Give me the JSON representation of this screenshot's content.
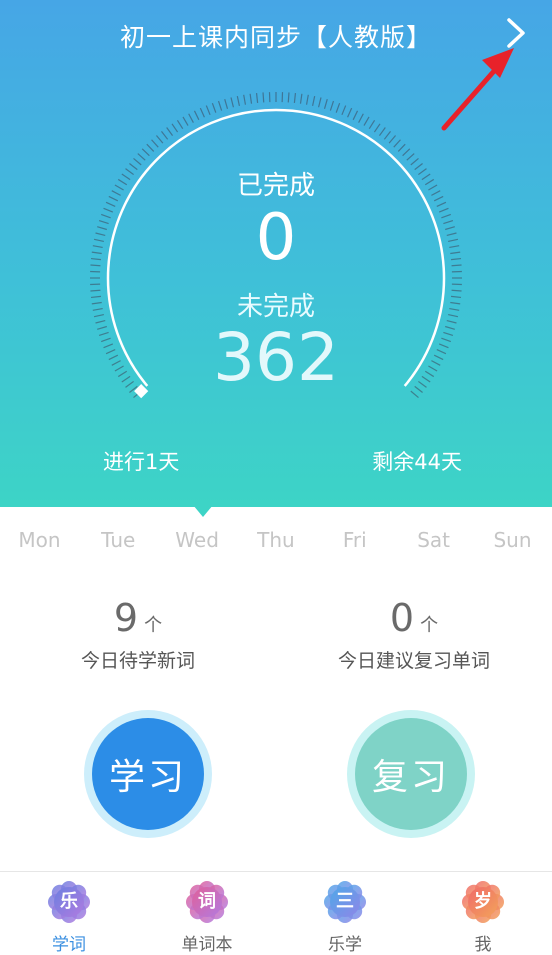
{
  "header": {
    "title": "初一上课内同步【人教版】"
  },
  "progress": {
    "completed_label": "已完成",
    "completed_value": "0",
    "remaining_label": "未完成",
    "remaining_value": "362",
    "days_elapsed": "进行1天",
    "days_left": "剩余44天",
    "fraction": 0
  },
  "week": {
    "days": [
      "Mon",
      "Tue",
      "Wed",
      "Thu",
      "Fri",
      "Sat",
      "Sun"
    ],
    "selected": "Wed"
  },
  "stats": {
    "new_words": {
      "value": "9",
      "unit": "个",
      "label": "今日待学新词"
    },
    "review_words": {
      "value": "0",
      "unit": "个",
      "label": "今日建议复习单词"
    }
  },
  "actions": {
    "learn": "学习",
    "review": "复习"
  },
  "tabs": [
    {
      "icon_char": "乐",
      "label": "学词",
      "colors": [
        "#6b7fe0",
        "#b07be0"
      ]
    },
    {
      "icon_char": "词",
      "label": "单词本",
      "colors": [
        "#e0609a",
        "#b27be0"
      ]
    },
    {
      "icon_char": "三",
      "label": "乐学",
      "colors": [
        "#4fa8e8",
        "#8f86e8"
      ]
    },
    {
      "icon_char": "岁",
      "label": "我",
      "colors": [
        "#f06a6a",
        "#f2a35a"
      ]
    }
  ],
  "colors": {
    "accent": "#2c8de7",
    "review": "#7fd3c7",
    "active_tab": "#3a8fe0"
  }
}
